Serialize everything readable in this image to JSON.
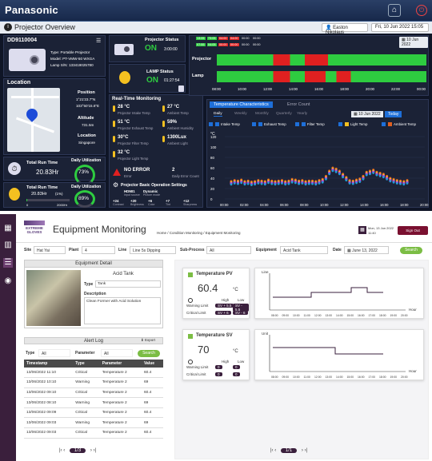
{
  "dashboard": {
    "brand": "Panasonic",
    "page_title": "Projector Overview",
    "user": "Easton Nikolaus",
    "date": "Fri, 10 Jun 2022",
    "time": "15:05",
    "device_id": "DD9110004",
    "device_info": [
      "Type: Portable Projector",
      "Model: PT-VMW-50 WXGA",
      "Lamp S/N: 133419025780"
    ],
    "location": {
      "title": "Location",
      "position_label": "Position",
      "lat": "1°21'23.7\"N",
      "lon": "103°50'15.6\"E",
      "altitude_label": "Altitude",
      "altitude": "731.5m",
      "location_label": "Location",
      "place": "Singapore"
    },
    "projector_status": {
      "title": "Projector Status",
      "state": "ON",
      "time": "3:00:00"
    },
    "lamp_status": {
      "title": "LAMP Status",
      "state": "ON",
      "time": "01:27:54"
    },
    "realtime": {
      "title": "Real-Time Monitoring",
      "metrics": [
        {
          "value": "28 °C",
          "label": "Projector Intake Temp"
        },
        {
          "value": "27 °C",
          "label": "Ambient Temp"
        },
        {
          "value": "51 °C",
          "label": "Projector Exhaust Temp"
        },
        {
          "value": "59%",
          "label": "Ambient Humidity"
        },
        {
          "value": "30°C",
          "label": "Projector Filter Temp"
        },
        {
          "value": "1300Lux",
          "label": "Ambient Light"
        },
        {
          "value": "32 °C",
          "label": "Projector Light Temp"
        }
      ],
      "error": {
        "value": "NO ERROR",
        "label": "Error"
      },
      "daily_error": {
        "value": "2",
        "label": "Daily Error Count"
      }
    },
    "basic_settings": {
      "title": "Projector Basic Operation Settings",
      "items": [
        {
          "value": "HDMI1",
          "label": "Input source"
        },
        {
          "value": "Dynamic",
          "label": "Picture mode"
        },
        {
          "value": "+24",
          "label": "Contrast"
        },
        {
          "value": "+20",
          "label": "Brightness"
        },
        {
          "value": "+6",
          "label": "Color"
        },
        {
          "value": "+7",
          "label": "Tint"
        },
        {
          "value": "+12",
          "label": "Sharpness"
        }
      ]
    },
    "runtime": {
      "total_label": "Total Run Time",
      "total_value": "20.83Hr",
      "util_label": "Daily Utilization",
      "util_value": "73%"
    },
    "lamp_runtime": {
      "total_label": "Total Run Time",
      "total_value": "20.83Hr",
      "pct": "(1%)",
      "scale_min": "0",
      "scale_max": "2000Hr",
      "util_label": "Daily Utilization",
      "util_value": "89%"
    },
    "timeline": {
      "date_chip": "10 Jun 2022",
      "row1_label": "Projector",
      "row2_label": "Lamp",
      "badges_top": [
        "13:05",
        "73:05",
        "04:00",
        "04:00",
        "00:00",
        "00:00"
      ],
      "badges_bottom": [
        "07:55",
        "04:05",
        "00:00",
        "00:00",
        "00:00",
        "00:00"
      ],
      "times": [
        "08:00",
        "10:00",
        "12:00",
        "14:00",
        "16:00",
        "18:00",
        "20:00",
        "22:00",
        "00:00"
      ]
    },
    "temp_chart": {
      "tab_active": "Temperature Characteristics",
      "tab_other": "Error Count",
      "periods": [
        "Daily",
        "Weekly",
        "Monthly",
        "Quarterly",
        "Yearly"
      ],
      "date_chip": "10 Jun 2022",
      "today": "Today",
      "legend": [
        "Intake Temp",
        "Exhaust Temp",
        "Filter Temp",
        "Light Temp",
        "Ambient Temp"
      ],
      "ylabel": "°C",
      "yticks": [
        "120",
        "100",
        "80",
        "60",
        "40",
        "20",
        "0"
      ],
      "xticks": [
        "00:00",
        "02:00",
        "04:00",
        "06:00",
        "08:00",
        "10:00",
        "12:00",
        "14:00",
        "16:00",
        "18:00",
        "20:00"
      ]
    }
  },
  "app": {
    "brand_line1": "EXTREME",
    "brand_line2": "GLOVES",
    "title": "Equipment Monitoring",
    "breadcrumb": "Home / Condition Monitoring / Equipment Monitoring",
    "date": "Mon, 13 Jun 2022",
    "time": "11:40",
    "signout": "Sign Out",
    "filters": {
      "site_label": "Site",
      "site": "Hat Yai",
      "plant_label": "Plant",
      "plant": "4",
      "line_label": "Line",
      "line": "Line 5s Dipping",
      "sub_label": "Sub-Process",
      "sub": "All",
      "equip_label": "Equipment",
      "equip": "Acid Tank",
      "date_label": "Date",
      "date": "June 13, 2022",
      "search": "Search"
    },
    "detail": {
      "header": "Equipment Detail",
      "name": "Acid Tank",
      "type_label": "Type",
      "type": "Tank",
      "desc_label": "Description",
      "desc": "Clean Former with Acid Solution"
    },
    "alert": {
      "header": "Alert Log",
      "export": "Export",
      "type_label": "Type",
      "type": "All",
      "param_label": "Parameter",
      "param": "All",
      "search": "Search",
      "columns": [
        "Timestamp",
        "Type",
        "Parameter",
        "Value"
      ],
      "rows": [
        [
          "13/06/2022 11:10",
          "Critical",
          "Temperature 2",
          "60.4"
        ],
        [
          "13/06/2022 10:10",
          "Warning",
          "Temperature 2",
          "69"
        ],
        [
          "13/06/2022 09:10",
          "Critical",
          "Temperature 2",
          "60.4"
        ],
        [
          "13/06/2022 08:10",
          "Warning",
          "Temperature 2",
          "69"
        ],
        [
          "13/06/2022 09:09",
          "Critical",
          "Temperature 2",
          "60.4"
        ],
        [
          "13/06/2022 09:03",
          "Warning",
          "Temperature 2",
          "69"
        ],
        [
          "13/06/2022 09:03",
          "Critical",
          "Temperature 2",
          "60.4"
        ]
      ],
      "page": "1/3"
    },
    "pv": {
      "title": "Temperature PV",
      "value": "60.4",
      "unit": "°C",
      "high": "High",
      "low": "Low",
      "warn_label": "Warning Limit",
      "warn_high": "SV + 5.5",
      "warn_low": "SV - 5.5",
      "crit_label": "Critical Limit",
      "crit_high": "SV + 6",
      "crit_low": "SV - 6",
      "chart_ylabel": "Line",
      "chart_xlabel": "Hour"
    },
    "sv": {
      "title": "Temperature SV",
      "value": "70",
      "unit": "°C",
      "high": "High",
      "low": "Low",
      "warn_label": "Warning Limit",
      "warn_high": "0",
      "warn_low": "0",
      "crit_label": "Critical Limit",
      "crit_high": "0",
      "crit_low": "0",
      "chart_ylabel": "Unit",
      "chart_xlabel": "Hour"
    },
    "chart_xticks": [
      "08:00",
      "09:00",
      "10:00",
      "11:00",
      "12:00",
      "13:00",
      "14:00",
      "15:00",
      "16:00",
      "17:00",
      "18:00",
      "19:00",
      "20:00"
    ],
    "right_page": "1/1"
  },
  "colors": {
    "green": "#2ecc40",
    "red": "#e02020",
    "plum": "#3a1f3c",
    "accent": "#7bbd44"
  }
}
